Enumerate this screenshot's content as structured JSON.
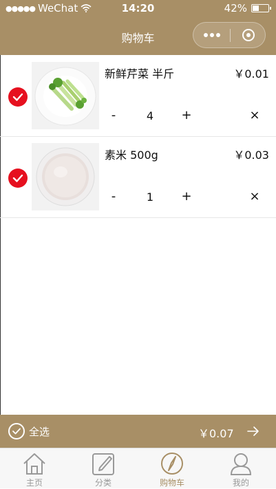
{
  "status_bar": {
    "signal": "●●●●●",
    "carrier": "WeChat",
    "time": "14:20",
    "battery": "42%",
    "battery_fraction": 0.42
  },
  "nav": {
    "title": "购物车"
  },
  "cart": {
    "items": [
      {
        "name": "新鲜芹菜 半斤",
        "price": "￥0.01",
        "quantity": "4",
        "minus_label": "-",
        "plus_label": "+",
        "remove_label": "×",
        "checked": true
      },
      {
        "name": "素米 500g",
        "price": "￥0.03",
        "quantity": "1",
        "minus_label": "-",
        "plus_label": "+",
        "remove_label": "×",
        "checked": true
      }
    ]
  },
  "footer": {
    "select_all_label": "全选",
    "total": "￥0.07"
  },
  "tabbar": {
    "tabs": [
      {
        "label": "主页",
        "icon": "home-icon",
        "active": false
      },
      {
        "label": "分类",
        "icon": "edit-icon",
        "active": false
      },
      {
        "label": "购物车",
        "icon": "compass-icon",
        "active": true
      },
      {
        "label": "我的",
        "icon": "user-icon",
        "active": false
      }
    ]
  },
  "colors": {
    "brand": "#a88f66",
    "check_red": "#e6101f",
    "tab_inactive": "#999999"
  }
}
